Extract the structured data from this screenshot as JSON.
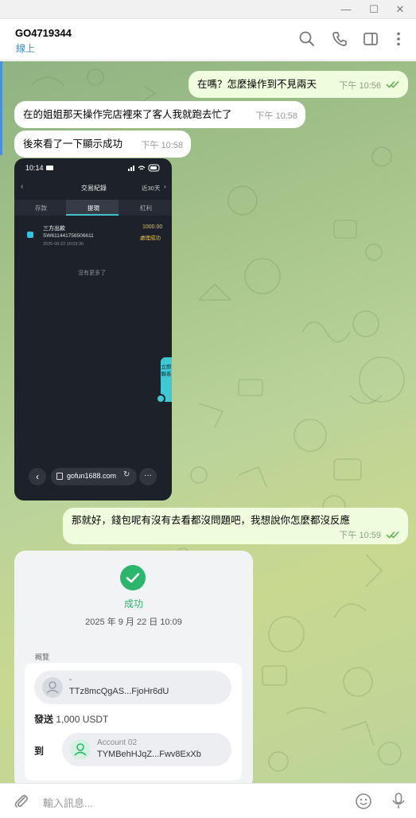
{
  "window": {
    "minimize": "—",
    "maximize": "☐",
    "close": "✕"
  },
  "header": {
    "name": "GO4719344",
    "status": "線上"
  },
  "messages": [
    {
      "text": "在嗎？怎麼操作到不見兩天",
      "time": "下午 10:56"
    },
    {
      "text": "在的姐姐那天操作完店裡來了客人我就跑去忙了",
      "time": "下午 10:58"
    },
    {
      "text": "後來看了一下顯示成功",
      "time": "下午 10:58"
    },
    {
      "text": "那就好，錢包呢有沒有去看都沒問題吧，我想說你怎麼都沒反應",
      "time": "下午 10:59"
    }
  ],
  "phone_shot": {
    "clock": "10:14",
    "title": "交易紀錄",
    "filter": "近30天",
    "tabs": [
      "存款",
      "提現",
      "紅利"
    ],
    "record": {
      "method": "三方出款",
      "id": "SW611441758506611",
      "date": "2025-09-22 10:03:30",
      "amount": "1000.00",
      "status": "處理成功"
    },
    "empty": "沒有更多了",
    "side_button": "立即聯系",
    "url": "gofun1688.com"
  },
  "tx_card": {
    "status": "成功",
    "datetime": "2025 年 9 月 22 日 10:09",
    "overview_label": "概覽",
    "from_name": "-",
    "from_address": "TTz8mcQgAS...FjoHr6dU",
    "send_label": "發送",
    "send_amount": "1,000 USDT",
    "to_label": "到",
    "to_name": "Account 02",
    "to_address": "TYMBehHJqZ...Fwv8ExXb"
  },
  "input": {
    "placeholder": "輸入訊息..."
  },
  "colors": {
    "outgoing": "#effdde",
    "incoming": "#ffffff",
    "success": "#2bb56d",
    "accent": "#3a8cc6"
  }
}
